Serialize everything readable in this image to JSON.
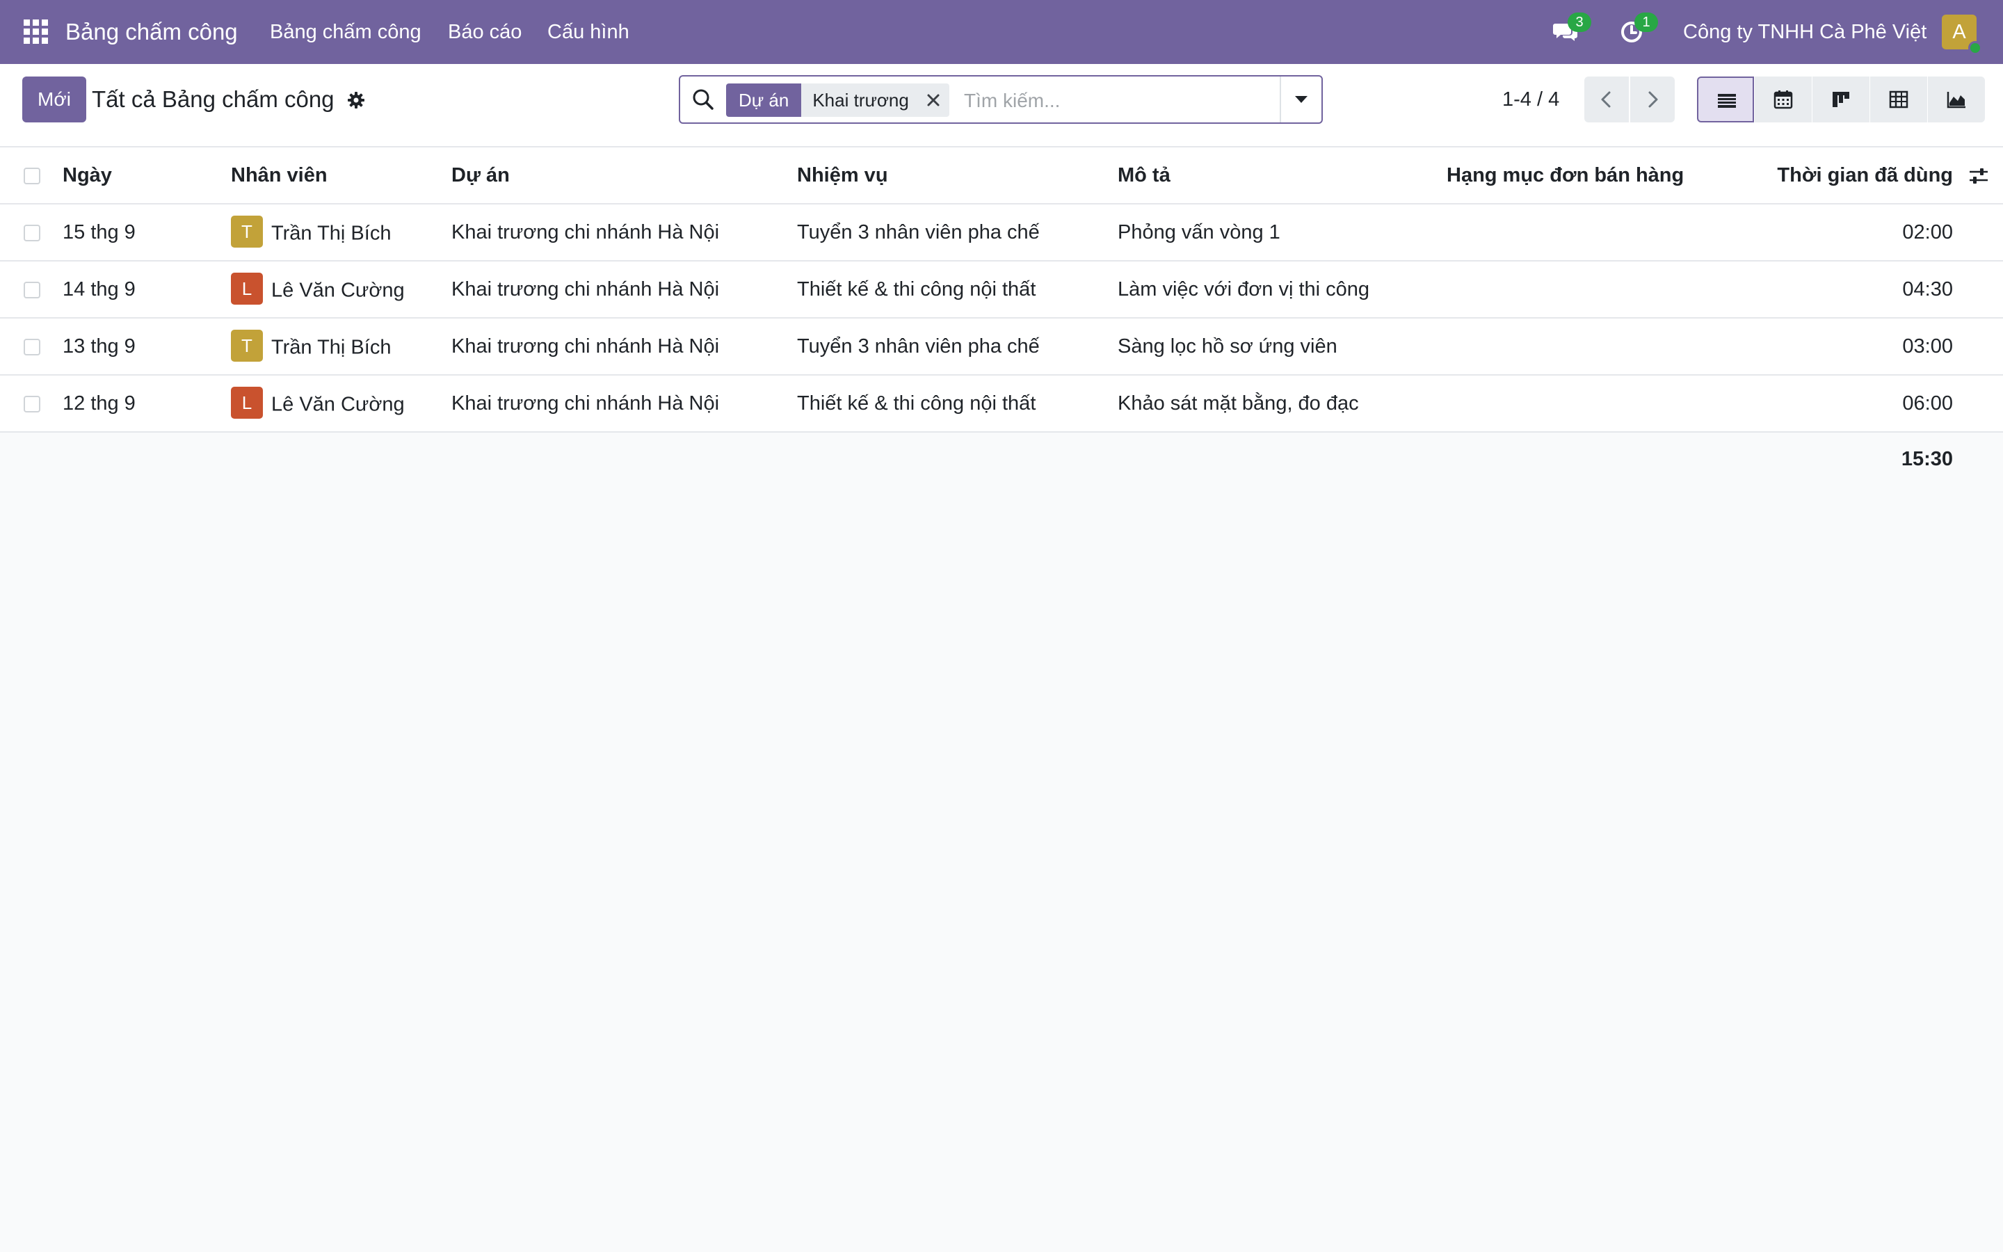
{
  "navbar": {
    "app_name": "Bảng chấm công",
    "menu": [
      "Bảng chấm công",
      "Báo cáo",
      "Cấu hình"
    ],
    "messages_count": "3",
    "activities_count": "1",
    "company": "Công ty TNHH Cà Phê Việt",
    "user_initial": "A",
    "user_avatar_color": "#c2a239",
    "brand_color": "#71639e"
  },
  "control": {
    "new_button": "Mới",
    "title": "Tất cả Bảng chấm công",
    "search": {
      "facet_label": "Dự án",
      "facet_value": "Khai trương",
      "placeholder": "Tìm kiếm..."
    },
    "pager": "1-4 / 4",
    "views": [
      "list-view-icon",
      "calendar-view-icon",
      "kanban-view-icon",
      "pivot-view-icon",
      "graph-view-icon"
    ],
    "active_view": "list"
  },
  "table": {
    "columns": [
      "Ngày",
      "Nhân viên",
      "Dự án",
      "Nhiệm vụ",
      "Mô tả",
      "Hạng mục đơn bán hàng",
      "Thời gian đã dùng"
    ],
    "rows": [
      {
        "date": "15 thg 9",
        "employee": "Trần Thị Bích",
        "initial": "T",
        "avatar_color": "#c2a239",
        "project": "Khai trương chi nhánh Hà Nội",
        "task": "Tuyển 3 nhân viên pha chế",
        "description": "Phỏng vấn vòng 1",
        "sale_line": "",
        "time": "02:00"
      },
      {
        "date": "14 thg 9",
        "employee": "Lê Văn Cường",
        "initial": "L",
        "avatar_color": "#c9522e",
        "project": "Khai trương chi nhánh Hà Nội",
        "task": "Thiết kế & thi công nội thất",
        "description": "Làm việc với đơn vị thi công",
        "sale_line": "",
        "time": "04:30"
      },
      {
        "date": "13 thg 9",
        "employee": "Trần Thị Bích",
        "initial": "T",
        "avatar_color": "#c2a239",
        "project": "Khai trương chi nhánh Hà Nội",
        "task": "Tuyển 3 nhân viên pha chế",
        "description": "Sàng lọc hồ sơ ứng viên",
        "sale_line": "",
        "time": "03:00"
      },
      {
        "date": "12 thg 9",
        "employee": "Lê Văn Cường",
        "initial": "L",
        "avatar_color": "#c9522e",
        "project": "Khai trương chi nhánh Hà Nội",
        "task": "Thiết kế & thi công nội thất",
        "description": "Khảo sát mặt bằng, đo đạc",
        "sale_line": "",
        "time": "06:00"
      }
    ],
    "total_time": "15:30"
  }
}
